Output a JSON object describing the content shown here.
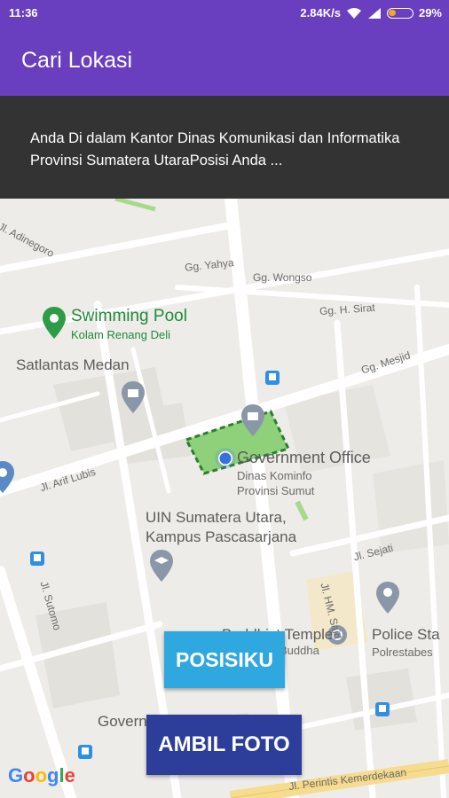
{
  "status_bar": {
    "time": "11:36",
    "network_speed": "2.84K/s",
    "battery": "29%",
    "icons": [
      "wifi-icon",
      "signal-icon",
      "battery-icon"
    ]
  },
  "app_bar": {
    "title": "Cari Lokasi",
    "color": "#6a3fbf"
  },
  "info_panel": {
    "text": "Anda Di dalam Kantor Dinas Komunikasi dan Informatika Provinsi Sumatera UtaraPosisi Anda ...",
    "background": "#333333"
  },
  "map": {
    "streets": {
      "adinegoro": "Jl. Adinegoro",
      "yahya": "Gg. Yahya",
      "wongso": "Gg. Wongso",
      "sirat": "Gg. H. Sirat",
      "mesjid": "Gg. Mesjid",
      "arif_lubis": "Jl. Arif Lubis",
      "sejati": "Jl. Sejati",
      "hm_said": "Jl. HM. Said",
      "sutomo": "Jl. Sutomo",
      "perintis": "Jl. Perintis Kemerdekaan"
    },
    "places": {
      "pool_title": "Swimming Pool",
      "pool_sub": "Kolam Renang Deli",
      "satlantas": "Satlantas Medan",
      "gov_office": "Government Office",
      "kominfo_line1": "Dinas Kominfo",
      "kominfo_line2": "Provinsi Sumut",
      "uin_line1": "UIN Sumatera Utara,",
      "uin_line2": "Kampus Pascasarjana",
      "temple": "Buddhist Temple",
      "temple_sub": "Buddha",
      "police": "Police Sta",
      "police_sub": "Polrestabes",
      "gov_bottom": "Governm"
    },
    "google_logo": "Google"
  },
  "buttons": {
    "posisiku": "POSISIKU",
    "ambil_foto": "AMBIL FOTO",
    "posisiku_color": "#2fa8e0",
    "ambil_color": "#2d3e9a"
  }
}
